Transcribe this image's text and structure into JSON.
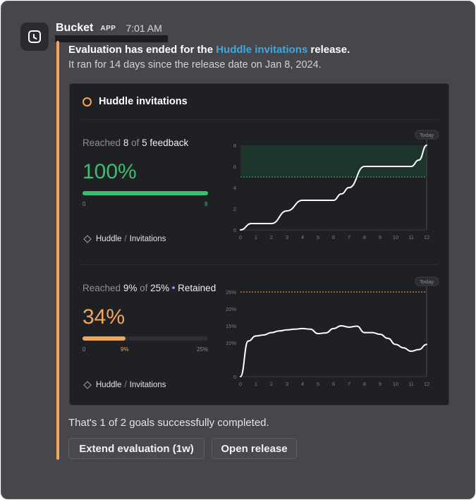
{
  "message": {
    "sender": "Bucket",
    "badge": "APP",
    "time": "7:01 AM",
    "line1_pre": "Evaluation has ended for the ",
    "line1_link": "Huddle invitations",
    "line1_post": " release.",
    "line2": "It ran for 14 days since the release date on Jan 8, 2024.",
    "summary": "That's 1 of 2 goals successfully completed."
  },
  "card": {
    "title": "Huddle invitations",
    "goal1": {
      "reached_label": "Reached",
      "value": "8",
      "of_label": "of",
      "target": "5",
      "unit": "feedback",
      "percent": "100%",
      "progress_fraction": 1.0,
      "bar_min": "0",
      "bar_value": "8",
      "feature": "Huddle",
      "feature_sep": "/",
      "feature_sub": "Invitations",
      "color": "#3cbd6f"
    },
    "goal2": {
      "reached_label": "Reached",
      "value": "9%",
      "of_label": "of",
      "target": "25%",
      "metric": "Retained",
      "percent": "34%",
      "progress_fraction": 0.34,
      "bar_min": "0",
      "bar_value": "9%",
      "bar_max": "25%",
      "feature": "Huddle",
      "feature_sep": "/",
      "feature_sub": "Invitations",
      "color": "#f0a65b"
    }
  },
  "buttons": {
    "extend": "Extend evaluation (1w)",
    "open": "Open release"
  },
  "chart_data": [
    {
      "type": "line",
      "x": [
        0,
        0.7,
        1,
        1.5,
        2,
        3,
        4,
        4.5,
        5,
        6,
        6.5,
        7,
        8,
        8.5,
        9,
        10,
        11,
        11.5,
        12
      ],
      "y": [
        0,
        0.6,
        0.6,
        0.6,
        0.6,
        1.8,
        2.8,
        2.8,
        2.8,
        2.8,
        3.4,
        4.0,
        6.0,
        6.0,
        6.0,
        6.0,
        6.0,
        6.6,
        8.0
      ],
      "x_ticks": [
        "0",
        "1",
        "2",
        "3",
        "4",
        "5",
        "6",
        "7",
        "8",
        "9",
        "10",
        "11",
        "12"
      ],
      "y_ticks": [
        "0",
        "2",
        "4",
        "6",
        "8"
      ],
      "xlim": [
        0,
        12
      ],
      "ylim": [
        0,
        8
      ],
      "target": 5,
      "target_band": [
        5,
        8
      ],
      "marker_label": "Today",
      "grid": false
    },
    {
      "type": "line",
      "x": [
        0,
        0.5,
        1,
        1.5,
        2,
        2.5,
        3,
        3.5,
        4,
        4.5,
        5,
        5.5,
        6,
        6.5,
        7,
        7.5,
        8,
        8.5,
        9,
        9.5,
        10,
        10.5,
        11,
        11.5,
        12
      ],
      "y": [
        0,
        10.5,
        12,
        12.3,
        13,
        13.5,
        13.8,
        14,
        14.2,
        14,
        12.7,
        12.9,
        14.2,
        15,
        14.6,
        14.9,
        13,
        13,
        12.5,
        11.3,
        9.5,
        8.5,
        7.5,
        8,
        9.5
      ],
      "x_ticks": [
        "0",
        "1",
        "2",
        "3",
        "4",
        "5",
        "6",
        "7",
        "8",
        "9",
        "10",
        "11",
        "12"
      ],
      "y_ticks": [
        "0",
        "10%",
        "15%",
        "20%",
        "25%"
      ],
      "xlim": [
        0,
        12
      ],
      "ylim": [
        0,
        25
      ],
      "target": 25,
      "marker_label": "Today",
      "grid": false
    }
  ]
}
